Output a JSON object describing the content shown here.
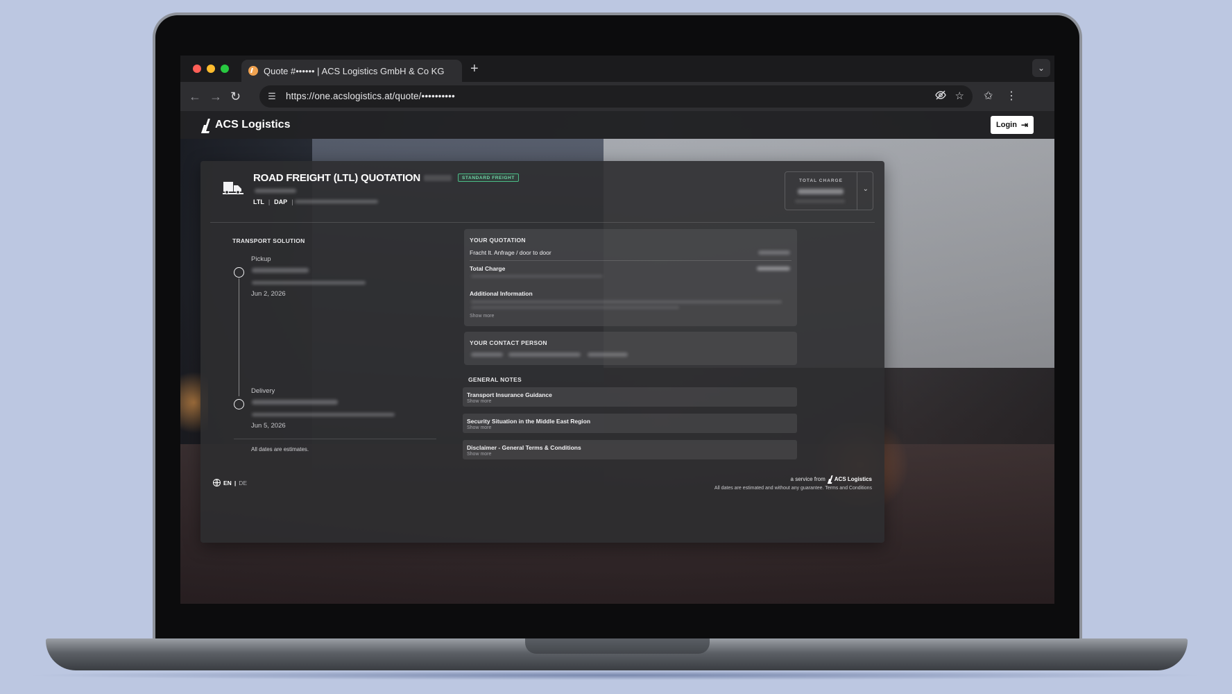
{
  "browser": {
    "tab_title": "Quote #•••••• | ACS Logistics GmbH & Co KG",
    "new_tab_symbol": "+",
    "url": "https://one.acslogistics.at/quote/••••••••••"
  },
  "site": {
    "brand": "ACS Logistics",
    "login_label": "Login"
  },
  "quote": {
    "title": "ROAD FREIGHT (LTL) QUOTATION",
    "badge": "STANDARD FREIGHT",
    "tags": [
      "LTL",
      "DAP"
    ],
    "total_charge_label": "TOTAL CHARGE"
  },
  "transport": {
    "label": "TRANSPORT SOLUTION",
    "pickup_label": "Pickup",
    "pickup_date": "Jun 2, 2026",
    "delivery_label": "Delivery",
    "delivery_date": "Jun 5, 2026",
    "estimates_note": "All dates are estimates."
  },
  "quotation": {
    "label": "YOUR QUOTATION",
    "line_item": "Fracht lt. Anfrage / door to door",
    "total_label": "Total Charge",
    "additional_info_label": "Additional Information",
    "show_more": "Show more"
  },
  "contact": {
    "label": "YOUR CONTACT PERSON"
  },
  "notes": {
    "label": "GENERAL NOTES",
    "items": [
      {
        "title": "Transport Insurance Guidance",
        "more": "Show more"
      },
      {
        "title": "Security Situation in the Middle East Region",
        "more": "Show more"
      },
      {
        "title": "Disclaimer - General Terms & Conditions",
        "more": "Show more"
      }
    ]
  },
  "footer": {
    "lang_en": "EN",
    "lang_sep": "|",
    "lang_de": "DE",
    "service_prefix": "a service from",
    "service_brand": "ACS Logistics",
    "disclaimer": "All dates are estimated and without any guarantee. Terms and Conditions"
  },
  "icons": {
    "back": "arrow-left-icon",
    "forward": "arrow-right-icon",
    "reload": "reload-icon",
    "site_settings": "tune-icon",
    "eye_off": "eye-off-icon",
    "bookmark": "star-icon",
    "extensions": "sparkle-star-icon",
    "menu": "kebab-menu-icon",
    "truck": "truck-icon",
    "globe": "globe-icon",
    "login": "login-arrow-icon"
  },
  "colors": {
    "badge_green": "#4bbc86",
    "traffic_red": "#ff5f57",
    "traffic_yellow": "#febc2e",
    "traffic_green": "#28c840"
  }
}
